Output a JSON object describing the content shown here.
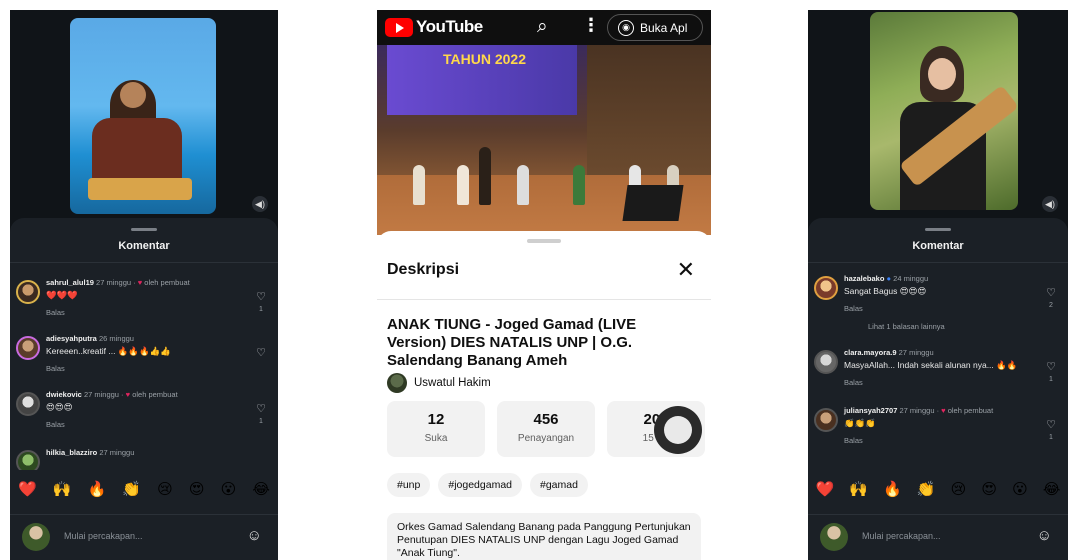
{
  "ig_left": {
    "sheet_title": "Komentar",
    "comments": [
      {
        "user": "sahrul_alul19",
        "meta": "27 minggu · ",
        "creator_like": "oleh pembuat",
        "text": "❤️❤️❤️",
        "reply": "Balas",
        "likes": "1"
      },
      {
        "user": "adiesyahputra",
        "meta": "26 minggu",
        "creator_like": "",
        "text": "Kereeen..kreatif ... 🔥🔥🔥👍👍",
        "reply": "Balas",
        "likes": ""
      },
      {
        "user": "dwiekovic",
        "meta": "27 minggu · ",
        "creator_like": "oleh pembuat",
        "text": "😍😍😍",
        "reply": "Balas",
        "likes": "1"
      },
      {
        "user": "hilkia_blazziro",
        "meta": "27 minggu",
        "creator_like": "",
        "text": "",
        "reply": "",
        "likes": ""
      }
    ],
    "emoji_bar": [
      "❤️",
      "🙌",
      "🔥",
      "👏",
      "😢",
      "😍",
      "😮",
      "😂"
    ],
    "compose_placeholder": "Mulai percakapan..."
  },
  "youtube": {
    "logo": "YouTube",
    "open_app": "Buka Apl",
    "banner_year": "TAHUN 2022",
    "description_title": "Deskripsi",
    "video_title": "ANAK TIUNG - Joged Gamad (LIVE Version) DIES NATALIS UNP | O.G. Salendang Banang Ameh",
    "channel": "Uswatul Hakim",
    "stats": [
      {
        "value": "12",
        "label": "Suka"
      },
      {
        "value": "456",
        "label": "Penayangan"
      },
      {
        "value": "202",
        "label": "15 De"
      }
    ],
    "tags": [
      "#unp",
      "#jogedgamad",
      "#gamad"
    ],
    "description_text": "Orkes Gamad Salendang Banang pada Panggung Pertunjukan Penutupan DIES NATALIS UNP dengan Lagu Joged Gamad \"Anak Tiung\"."
  },
  "ig_right": {
    "sheet_title": "Komentar",
    "comments": [
      {
        "user": "hazalebako",
        "meta": "24 minggu",
        "creator_like": "",
        "text": "Sangat Bagus 😍😍😍",
        "reply": "Balas",
        "likes": "2"
      },
      {
        "user": "clara.mayora.9",
        "meta": "27 minggu",
        "creator_like": "",
        "text": "MasyaAllah... Indah sekali alunan nya... 🔥🔥",
        "reply": "Balas",
        "likes": "1"
      },
      {
        "user": "juliansyah2707",
        "meta": "27 minggu · ",
        "creator_like": "oleh pembuat",
        "text": "👏👏👏",
        "reply": "Balas",
        "likes": "1"
      }
    ],
    "more_replies": "Lihat 1 balasan lainnya",
    "emoji_bar": [
      "❤️",
      "🙌",
      "🔥",
      "👏",
      "😢",
      "😍",
      "😮",
      "😂"
    ],
    "compose_placeholder": "Mulai percakapan..."
  }
}
